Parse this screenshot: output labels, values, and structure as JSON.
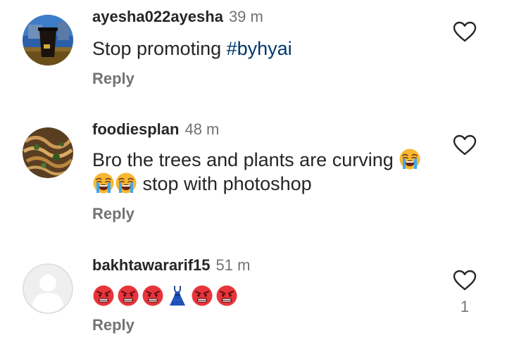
{
  "comments": [
    {
      "username": "ayesha022ayesha",
      "time": "39 m",
      "text_before": "Stop promoting ",
      "hashtag": "#byhyai",
      "reply_label": "Reply",
      "avatar_icon": "coffee-cup-photo-avatar"
    },
    {
      "username": "foodiesplan",
      "time": "48 m",
      "text_line1": "Bro the trees and plants are curving",
      "text_line2": "stop with photoshop",
      "emojis": [
        "loudly-crying-face",
        "loudly-crying-face",
        "loudly-crying-face"
      ],
      "reply_label": "Reply",
      "avatar_icon": "noodles-photo-avatar"
    },
    {
      "username": "bakhtawararif15",
      "time": "51 m",
      "emojis": [
        "pouting-face",
        "pouting-face",
        "pouting-face",
        "dress",
        "pouting-face",
        "pouting-face"
      ],
      "reply_label": "Reply",
      "like_count": "1",
      "avatar_icon": "default-user-avatar"
    }
  ],
  "colors": {
    "text": "#262626",
    "secondary": "#737373",
    "hashtag": "#00376b"
  }
}
